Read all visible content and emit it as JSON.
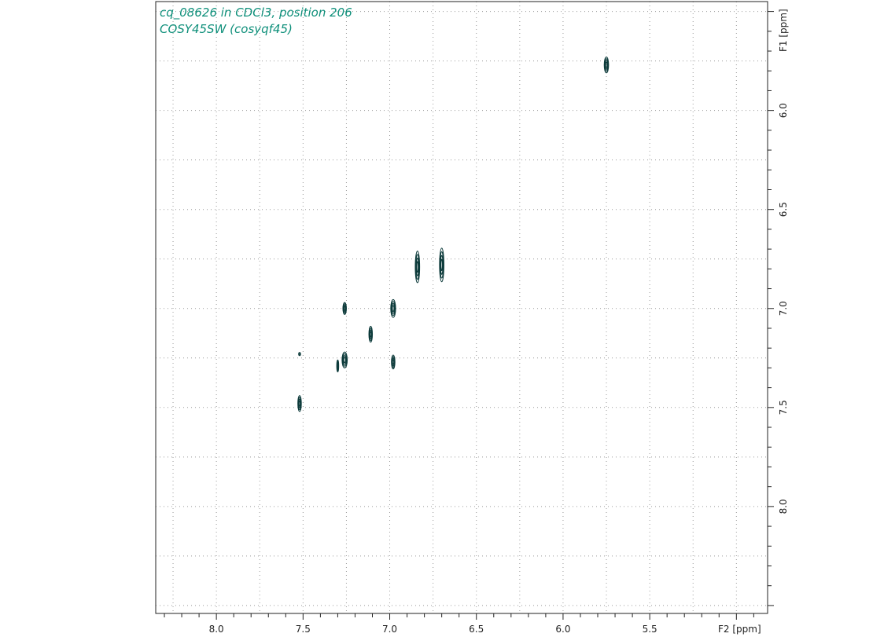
{
  "chart_data": {
    "type": "contour",
    "title_lines": [
      "cq_08626 in CDCl3, position 206",
      "COSY45SW (cosyqf45)"
    ],
    "xlabel": "F2 [ppm]",
    "ylabel": "F1 [ppm]",
    "xlim": [
      8.35,
      4.82
    ],
    "ylim": [
      5.45,
      8.54
    ],
    "x_ticks": [
      8.0,
      7.5,
      7.0,
      6.5,
      6.0,
      5.5
    ],
    "x_tick_labels": [
      "8.0",
      "7.5",
      "7.0",
      "6.5",
      "6.0",
      "5.5"
    ],
    "y_ticks": [
      6.0,
      6.5,
      7.0,
      7.5,
      8.0
    ],
    "y_tick_labels": [
      "6.0",
      "6.5",
      "7.0",
      "7.5",
      "8.0"
    ],
    "grid": true,
    "contour_color": "#0d3b3b",
    "title_color": "#0e8f7a",
    "peaks": [
      {
        "x": 5.75,
        "y": 5.77,
        "w": 0.025,
        "h": 0.08
      },
      {
        "x": 6.7,
        "y": 6.78,
        "w": 0.025,
        "h": 0.17
      },
      {
        "x": 6.84,
        "y": 6.79,
        "w": 0.025,
        "h": 0.16
      },
      {
        "x": 6.98,
        "y": 7.0,
        "w": 0.028,
        "h": 0.09
      },
      {
        "x": 6.98,
        "y": 7.27,
        "w": 0.02,
        "h": 0.07
      },
      {
        "x": 7.11,
        "y": 7.13,
        "w": 0.02,
        "h": 0.08
      },
      {
        "x": 7.26,
        "y": 7.0,
        "w": 0.02,
        "h": 0.06
      },
      {
        "x": 7.26,
        "y": 7.26,
        "w": 0.03,
        "h": 0.08
      },
      {
        "x": 7.3,
        "y": 7.29,
        "w": 0.01,
        "h": 0.06
      },
      {
        "x": 7.52,
        "y": 7.23,
        "w": 0.004,
        "h": 0.012
      },
      {
        "x": 7.52,
        "y": 7.48,
        "w": 0.02,
        "h": 0.08
      }
    ]
  }
}
